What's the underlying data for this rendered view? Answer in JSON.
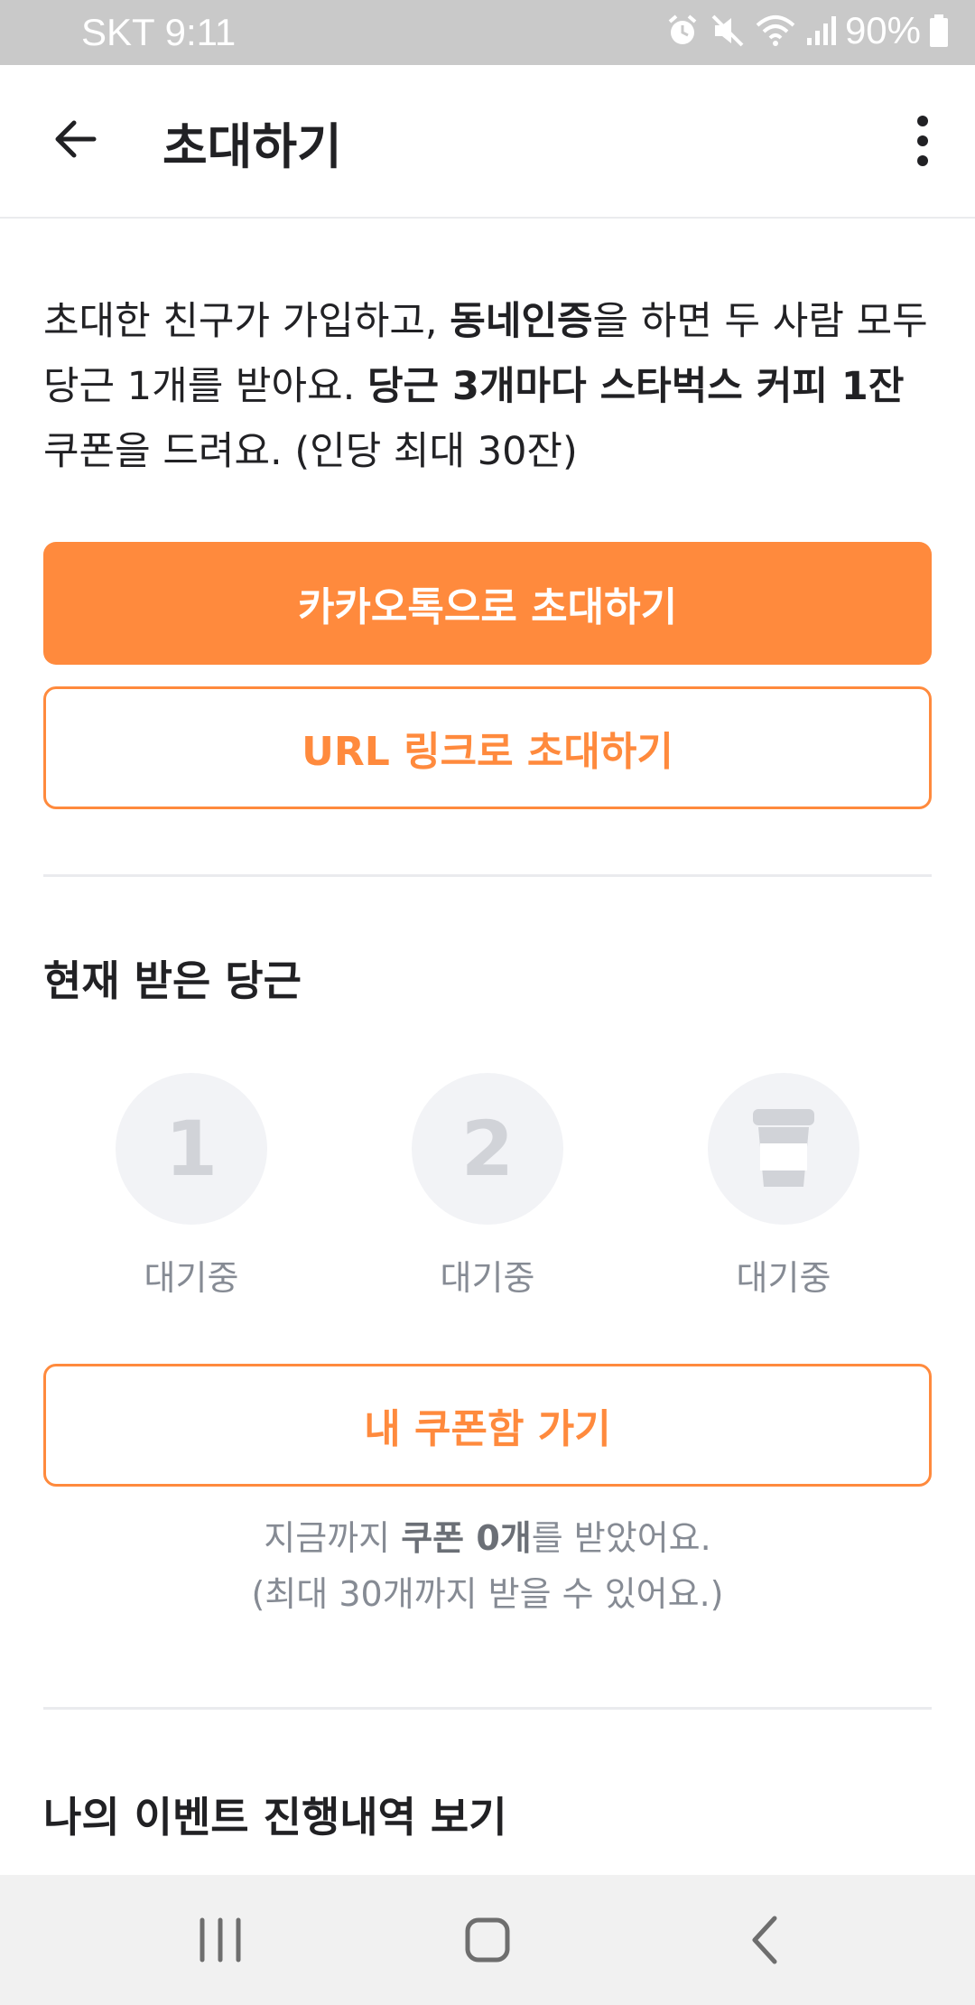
{
  "status_bar": {
    "carrier_time": "SKT 9:11",
    "battery": "90%",
    "icons": [
      "alarm-icon",
      "mute-icon",
      "wifi-icon",
      "signal-icon",
      "battery-icon"
    ]
  },
  "header": {
    "title": "초대하기",
    "back_icon": "arrow-left-icon",
    "more_icon": "more-vertical-icon"
  },
  "intro": {
    "p1": "초대한 친구가 가입하고, ",
    "b1": "동네인증",
    "p2": "을 하면 두 사람 모두 당근 1개를 받아요. ",
    "b2": "당근 3개마다 스타벅스 커피 1잔",
    "p3": " 쿠폰을 드려요. (인당 최대 30잔)"
  },
  "buttons": {
    "kakao": "카카오톡으로 초대하기",
    "url": "URL 링크로 초대하기",
    "coupon_box": "내 쿠폰함 가기"
  },
  "carrots": {
    "title": "현재 받은 당근",
    "steps": [
      {
        "mark": "1",
        "label": "대기중"
      },
      {
        "mark": "2",
        "label": "대기중"
      },
      {
        "mark": "coffee-cup-icon",
        "label": "대기중"
      }
    ]
  },
  "coupon_note": {
    "line1_pre": "지금까지 ",
    "line1_bold": "쿠폰 0개",
    "line1_post": "를 받았어요.",
    "line2": "(최대 30개까지 받을 수 있어요.)"
  },
  "history": {
    "title": "나의 이벤트 진행내역 보기"
  },
  "colors": {
    "accent": "#ff8a3d",
    "status_bar": "#c9c9c9",
    "muted_text": "#868b94",
    "circle_bg": "#f2f3f6"
  },
  "nav_bar": {
    "icons": [
      "recent-apps-icon",
      "home-icon",
      "back-icon"
    ]
  }
}
